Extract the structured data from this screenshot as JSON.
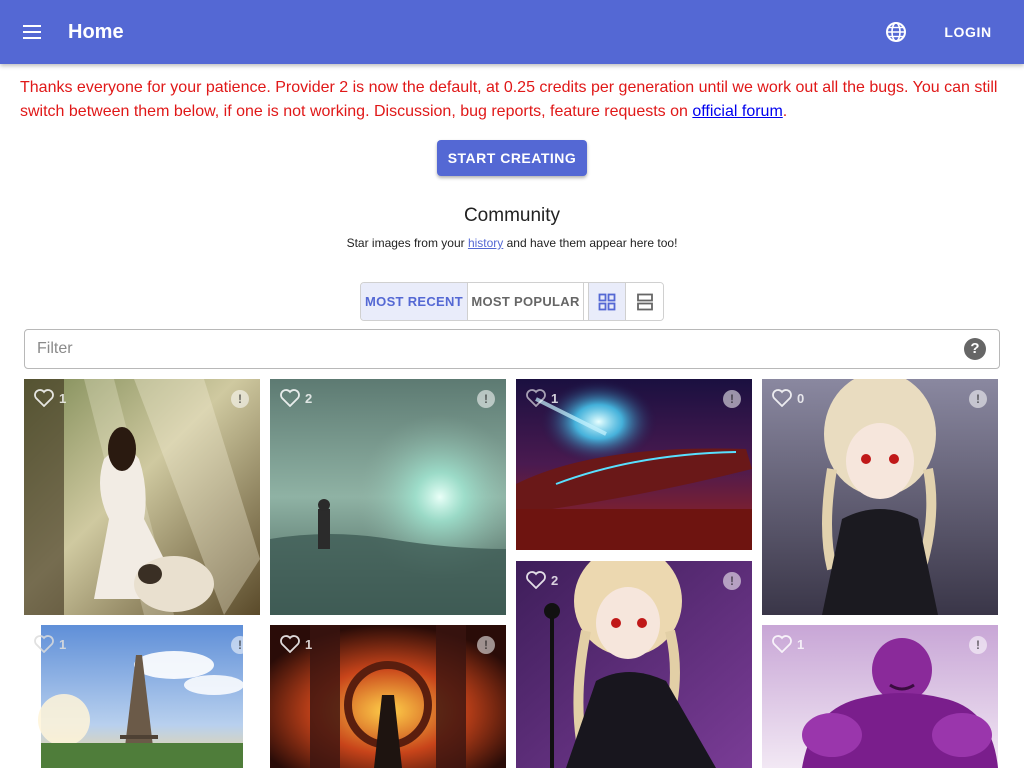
{
  "appbar": {
    "title": "Home",
    "login_label": "LOGIN",
    "color": "#5468d4"
  },
  "notice": {
    "text": "Thanks everyone for your patience. Provider 2 is now the default, at 0.25 credits per generation until we work out all the bugs. You can still switch between them below, if one is not working. Discussion, bug reports, feature requests on ",
    "link_text": "official forum",
    "end": ".",
    "color": "#e01818"
  },
  "start_button": {
    "label": "START CREATING"
  },
  "community": {
    "title": "Community",
    "sub_before": "Star images from your ",
    "sub_link": "history",
    "sub_after": " and have them appear here too!"
  },
  "sort_tabs": {
    "recent": "MOST RECENT",
    "popular": "MOST POPULAR",
    "selected": "MOST RECENT"
  },
  "view_modes": [
    "grid-view-icon",
    "list-view-icon"
  ],
  "filter": {
    "placeholder": "Filter",
    "value": ""
  },
  "gallery": [
    {
      "likes": "1",
      "subject": "girl in white dress with sheep in sunlit forest"
    },
    {
      "likes": "2",
      "subject": "man standing in misty green field with glowing light"
    },
    {
      "likes": "1",
      "subject": "spaceship over red glowing sea with comet"
    },
    {
      "likes": "0",
      "subject": "blonde anime girl with braids in black uniform"
    },
    {
      "likes": "2",
      "subject": "blonde anime girl with braids near microphone"
    },
    {
      "likes": "1",
      "subject": "eiffel tower at sunset"
    },
    {
      "likes": "1",
      "subject": "ornate fiery temple with warrior figure"
    },
    {
      "likes": "1",
      "subject": "purple muscular orc"
    }
  ]
}
